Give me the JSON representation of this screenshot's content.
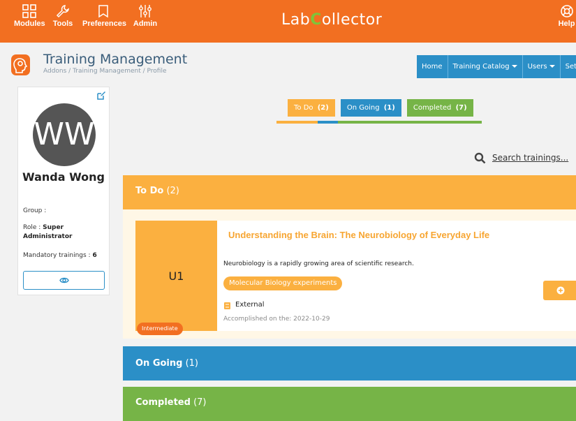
{
  "topbar": {
    "items": [
      {
        "label": "Modules",
        "icon": "modules-icon"
      },
      {
        "label": "Tools",
        "icon": "wrench-icon"
      },
      {
        "label": "Preferences",
        "icon": "bookmark-icon"
      },
      {
        "label": "Admin",
        "icon": "sliders-icon"
      },
      {
        "label": "Help",
        "icon": "lifebuoy-icon"
      }
    ],
    "logo_prefix": "Lab",
    "logo_c": "C",
    "logo_suffix": "ollector",
    "color": "#f26f21"
  },
  "header": {
    "title": "Training Management",
    "breadcrumb": "Addons / Training Management / Profile"
  },
  "topnav": {
    "items": [
      {
        "label": "Home",
        "dropdown": false
      },
      {
        "label": "Training Catalog",
        "dropdown": true
      },
      {
        "label": "Users",
        "dropdown": true
      },
      {
        "label": "Setup",
        "dropdown": false
      }
    ]
  },
  "profile": {
    "initials": "WW",
    "name": "Wanda Wong",
    "group_label": "Group :",
    "group_value": "",
    "role_label": "Role :",
    "role_value": "Super Administrator",
    "mandatory_label": "Mandatory trainings :",
    "mandatory_value": "6"
  },
  "status_tabs": {
    "todo_label": "To Do",
    "todo_count": "(2)",
    "ongoing_label": "On Going",
    "ongoing_count": "(1)",
    "completed_label": "Completed",
    "completed_count": "(7)"
  },
  "progress": {
    "todo": 2,
    "ongoing": 1,
    "completed": 7
  },
  "search": {
    "placeholder": "Search trainings..."
  },
  "sections": {
    "todo": {
      "label": "To Do",
      "count": "(2)"
    },
    "ongoing": {
      "label": "On Going",
      "count": "(1)"
    },
    "completed": {
      "label": "Completed",
      "count": "(7)"
    }
  },
  "training_card": {
    "code": "U1",
    "level": "Intermediate",
    "title": "Understanding the Brain: The Neurobiology of Everyday Life",
    "description": "Neurobiology is a rapidly growing area of scientific research.",
    "tag": "Molecular Biology experiments",
    "type": "External",
    "accomplished": "Accomplished on the: 2022-10-29"
  },
  "colors": {
    "orange": "#f26f21",
    "todo": "#fbb040",
    "ongoing": "#2b8fc7",
    "completed": "#76b447"
  }
}
